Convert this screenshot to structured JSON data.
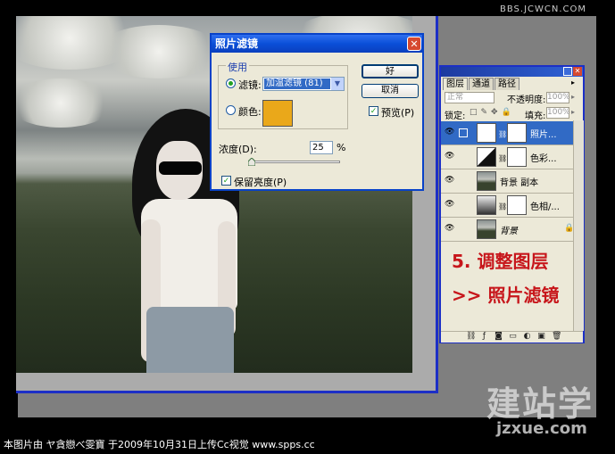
{
  "watermark_top": "BBS.JCWCN.COM",
  "dialog": {
    "title": "照片滤镜",
    "close_glyph": "✕",
    "use_group_label": "使用",
    "filter_label": "滤镜:",
    "filter_value": "加温滤镜 (81)",
    "color_label": "颜色:",
    "color_value": "#EAA81A",
    "ok_button": "好",
    "cancel_button": "取消",
    "preview_label": "预览(P)",
    "preview_checked": true,
    "density_label": "浓度(D):",
    "density_value": "25",
    "density_unit": "%",
    "preserve_luminosity_label": "保留亮度(P)",
    "preserve_luminosity_checked": true,
    "filter_selected": true,
    "color_selected": false
  },
  "layers_panel": {
    "tabs": [
      "图层",
      "通道",
      "路径"
    ],
    "blend_mode": "正常",
    "opacity_label": "不透明度:",
    "opacity_value": "100%",
    "lock_label": "锁定:",
    "fill_label": "填充:",
    "fill_value": "100%",
    "layers": [
      {
        "name": "照片...",
        "selected": true
      },
      {
        "name": "色彩...",
        "selected": false
      },
      {
        "name": "背景 副本",
        "selected": false
      },
      {
        "name": "色相/...",
        "selected": false
      },
      {
        "name": "背景",
        "selected": false
      }
    ]
  },
  "annotations": {
    "step": "5. 调整图层",
    "action": ">> 照片滤镜"
  },
  "caption": "本图片由 ヤ貪戀べ雯寶 于2009年10月31日上传Cc视觉 www.spps.cc",
  "logo": {
    "chinese": "建站学",
    "url": "jzxue.com"
  }
}
